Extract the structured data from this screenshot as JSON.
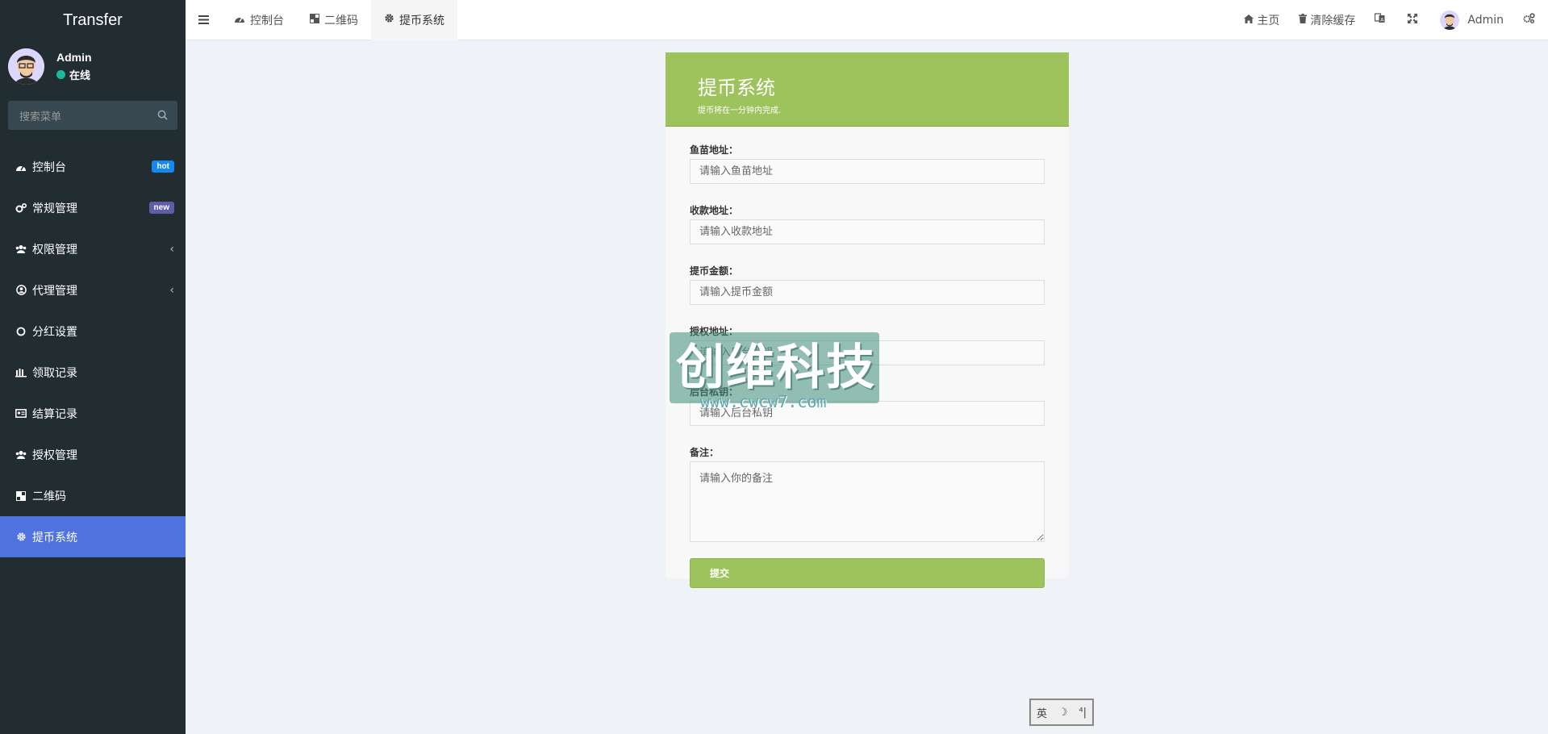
{
  "app": {
    "brand": "Transfer"
  },
  "user": {
    "name": "Admin",
    "status": "在线"
  },
  "sidebar": {
    "search_placeholder": "搜索菜单",
    "items": [
      {
        "label": "控制台",
        "icon": "dashboard-icon",
        "badge": "hot"
      },
      {
        "label": "常规管理",
        "icon": "cogs-icon",
        "badge": "new"
      },
      {
        "label": "权限管理",
        "icon": "group-icon",
        "chevron": "‹"
      },
      {
        "label": "代理管理",
        "icon": "user-circle-icon",
        "chevron": "‹"
      },
      {
        "label": "分红设置",
        "icon": "circle-icon"
      },
      {
        "label": "领取记录",
        "icon": "bars-icon"
      },
      {
        "label": "结算记录",
        "icon": "id-card-icon"
      },
      {
        "label": "授权管理",
        "icon": "group-icon"
      },
      {
        "label": "二维码",
        "icon": "qrcode-icon"
      },
      {
        "label": "提币系统",
        "icon": "gear-icon",
        "active": true
      }
    ]
  },
  "topbar": {
    "tabs": [
      {
        "label": "控制台",
        "icon": "dashboard-icon"
      },
      {
        "label": "二维码",
        "icon": "qrcode-icon"
      },
      {
        "label": "提币系统",
        "icon": "gear-icon",
        "active": true
      }
    ],
    "home_label": "主页",
    "clear_cache_label": "清除缓存",
    "user_label": "Admin"
  },
  "form": {
    "title": "提币系统",
    "subtitle": "提币将在一分钟内完成.",
    "fields": [
      {
        "label": "鱼苗地址：",
        "placeholder": "请输入鱼苗地址"
      },
      {
        "label": "收款地址：",
        "placeholder": "请输入收款地址"
      },
      {
        "label": "提币金额：",
        "placeholder": "请输入提币金额"
      },
      {
        "label": "授权地址：",
        "placeholder": "请输入后台私钥"
      },
      {
        "label": "后台私钥：",
        "placeholder": "请输入后台私钥"
      }
    ],
    "note_label": "备注：",
    "note_placeholder": "请输入你的备注",
    "submit_label": "提交"
  },
  "watermark": {
    "title": "创维科技",
    "url": "www.cwcw7.com"
  },
  "ime": {
    "mode": "英",
    "moon": "☽",
    "punct": "⁴|"
  },
  "colors": {
    "sidebar_bg": "#222d32",
    "active_menu": "#4e73df",
    "header_green": "#9dc35c",
    "online_green": "#18bc9c",
    "badge_hot": "#1688f1",
    "badge_new": "#605ca8"
  }
}
